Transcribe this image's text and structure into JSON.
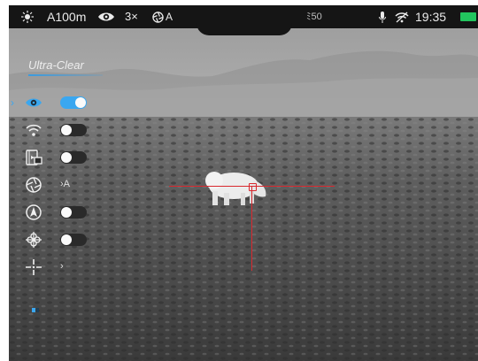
{
  "status_bar": {
    "brightness_icon": "sun-icon",
    "range": "A100m",
    "eye_icon": "eye-icon",
    "zoom": "3×",
    "calibration_icon": "aperture-icon",
    "calibration_mode": "A",
    "battery_badge": "ﾐ50",
    "mic_icon": "microphone-icon",
    "wifi_icon": "wifi-off-icon",
    "time": "19:35",
    "battery_icon": "battery-icon",
    "battery_color": "#22c55e"
  },
  "mode": {
    "title": "Ultra-Clear",
    "accent": "#3aa7f0"
  },
  "menu": [
    {
      "icon": "eye-icon",
      "type": "toggle",
      "state": "on",
      "selected": true
    },
    {
      "icon": "wifi-icon",
      "type": "toggle",
      "state": "off"
    },
    {
      "icon": "picture-in-picture-icon",
      "type": "toggle",
      "state": "off"
    },
    {
      "icon": "aperture-icon",
      "type": "value",
      "value": "›A"
    },
    {
      "icon": "compass-icon",
      "type": "toggle",
      "state": "off"
    },
    {
      "icon": "stabilization-icon",
      "type": "toggle",
      "state": "off"
    },
    {
      "icon": "crosshair-icon",
      "type": "submenu",
      "value": "›"
    }
  ],
  "reticle_color": "#d8282e",
  "scene": {
    "type": "thermal-image",
    "subject": "boar-silhouette"
  }
}
